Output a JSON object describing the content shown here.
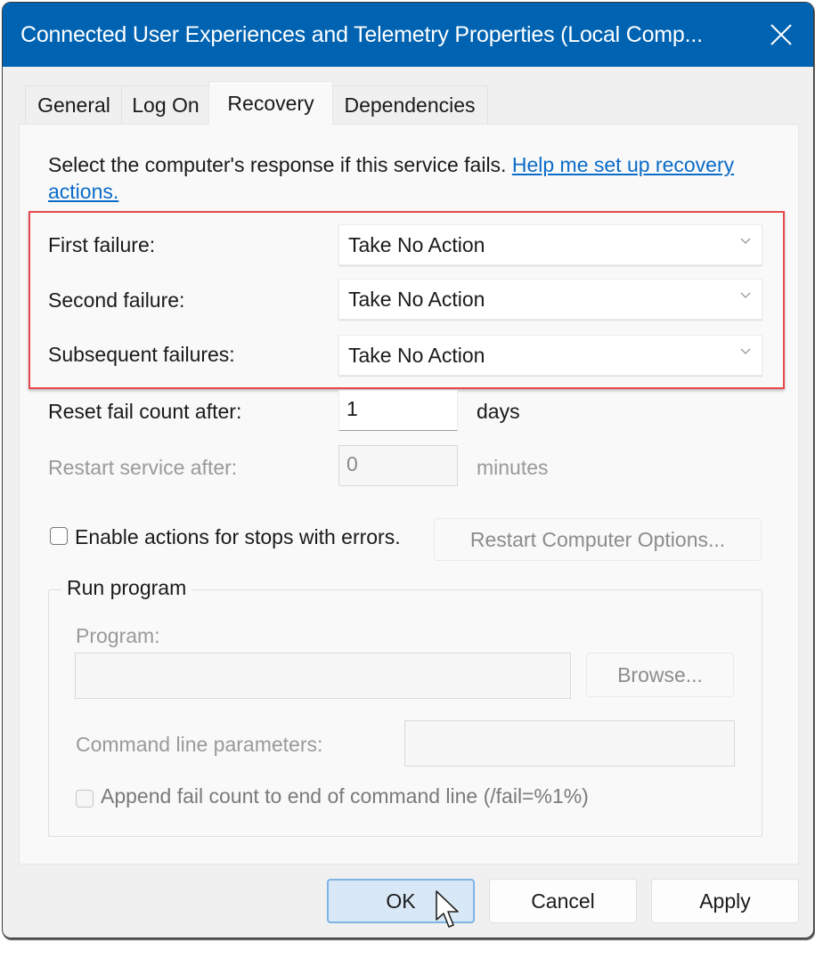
{
  "window": {
    "title": "Connected User Experiences and Telemetry Properties (Local Comp...",
    "close_icon": "close-icon",
    "titlebar_color": "#0063b1"
  },
  "tabs": [
    {
      "label": "General",
      "active": false
    },
    {
      "label": "Log On",
      "active": false
    },
    {
      "label": "Recovery",
      "active": true
    },
    {
      "label": "Dependencies",
      "active": false
    }
  ],
  "recovery": {
    "intro_text": "Select the computer's response if this service fails. ",
    "help_link": "Help me set up recovery actions.",
    "highlight_color": "#e8494c",
    "failures": [
      {
        "label": "First failure:",
        "value": "Take No Action"
      },
      {
        "label": "Second failure:",
        "value": "Take No Action"
      },
      {
        "label": "Subsequent failures:",
        "value": "Take No Action"
      }
    ],
    "reset_fail_count": {
      "label": "Reset fail count after:",
      "value": "1",
      "unit": "days"
    },
    "restart_service": {
      "label": "Restart service after:",
      "value": "0",
      "unit": "minutes",
      "disabled": true
    },
    "enable_actions": {
      "label": "Enable actions for stops with errors.",
      "checked": false
    },
    "restart_computer_options": "Restart Computer Options...",
    "run_program": {
      "title": "Run program",
      "program_label": "Program:",
      "program_value": "",
      "browse": "Browse...",
      "cmd_label": "Command line parameters:",
      "cmd_value": "",
      "append_label": "Append fail count to end of command line (/fail=%1%)",
      "append_checked": false
    }
  },
  "buttons": {
    "ok": "OK",
    "cancel": "Cancel",
    "apply": "Apply"
  }
}
